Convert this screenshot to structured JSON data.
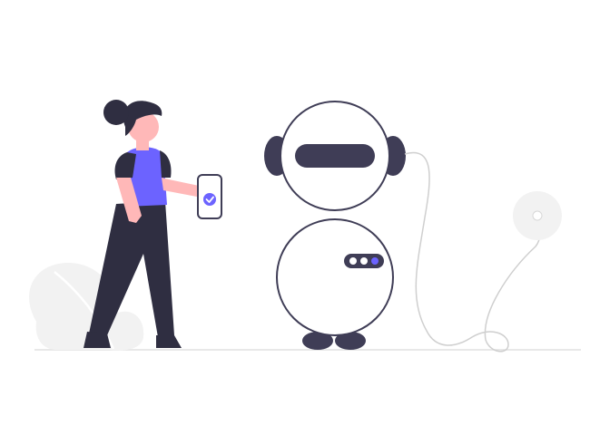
{
  "scene": {
    "description_visible_text": [],
    "colors": {
      "background": "#ffffff",
      "ink": "#3f3d56",
      "accent": "#6c63ff",
      "skin": "#ffb8b8",
      "hair": "#2f2e41",
      "light_gray": "#f2f2f2",
      "stroke_gray": "#e6e6e6",
      "cable": "#cfcfcf",
      "ground": "#e0e0e0"
    },
    "icons": {
      "phone_status": "check-circle-icon",
      "robot_indicator": "three-dot-lights-icon",
      "wall_socket": "outlet-icon"
    },
    "robot": {
      "indicator_lights": [
        "#ffffff",
        "#ffffff",
        "#6c63ff"
      ]
    }
  }
}
